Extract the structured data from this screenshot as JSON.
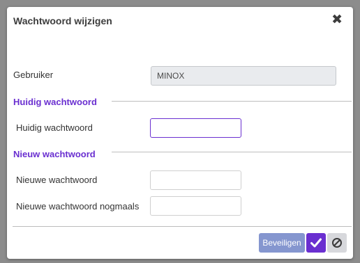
{
  "dialog": {
    "title": "Wachtwoord wijzigen",
    "close_icon": "close-icon"
  },
  "form": {
    "user_label": "Gebruiker",
    "user_value": "MINOX",
    "current_section": "Huidig wachtwoord",
    "current_label": "Huidig wachtwoord",
    "current_value": "",
    "new_section": "Nieuw wachtwoord",
    "new_label": "Nieuwe wachtwoord",
    "new_value": "",
    "repeat_label": "Nieuwe wachtwoord nogmaals",
    "repeat_value": ""
  },
  "footer": {
    "protect_label": "Beveiligen",
    "ok_icon": "checkmark-icon",
    "cancel_icon": "cancel-icon"
  },
  "colors": {
    "accent": "#6a2fd0",
    "protect_button": "#8596cf",
    "cancel_button": "#d7d8dc"
  }
}
